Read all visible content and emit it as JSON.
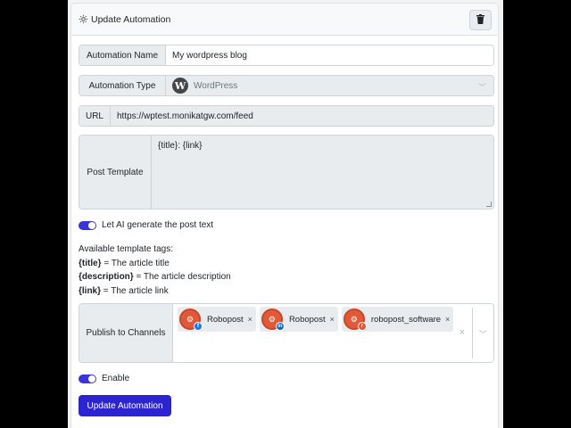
{
  "header": {
    "title": "Update Automation"
  },
  "form": {
    "name_label": "Automation Name",
    "name_value": "My wordpress blog",
    "type_label": "Automation Type",
    "type_value": "WordPress",
    "url_label": "URL",
    "url_value": "https://wptest.monikatgw.com/feed",
    "template_label": "Post Template",
    "template_value": "{title}: {link}",
    "ai_toggle_label": "Let AI generate the post text",
    "ai_toggle_on": true
  },
  "template_tags": {
    "heading": "Available template tags:",
    "items": [
      {
        "tag": "{title}",
        "desc": " = The article title"
      },
      {
        "tag": "{description}",
        "desc": " = The article description"
      },
      {
        "tag": "{link}",
        "desc": " = The article link"
      }
    ]
  },
  "channels": {
    "label": "Publish to Channels",
    "items": [
      {
        "name": "Robopost",
        "network": "facebook",
        "badge": "f"
      },
      {
        "name": "Robopost",
        "network": "linkedin",
        "badge": "in"
      },
      {
        "name": "robopost_software",
        "network": "reddit",
        "badge": "r"
      }
    ],
    "remove_glyph": "×",
    "clear_glyph": "×"
  },
  "enable": {
    "label": "Enable",
    "on": true
  },
  "submit_label": "Update Automation",
  "colors": {
    "primary": "#2c24d1",
    "toggle": "#3b35d8",
    "avatar": "#e05a3a"
  }
}
